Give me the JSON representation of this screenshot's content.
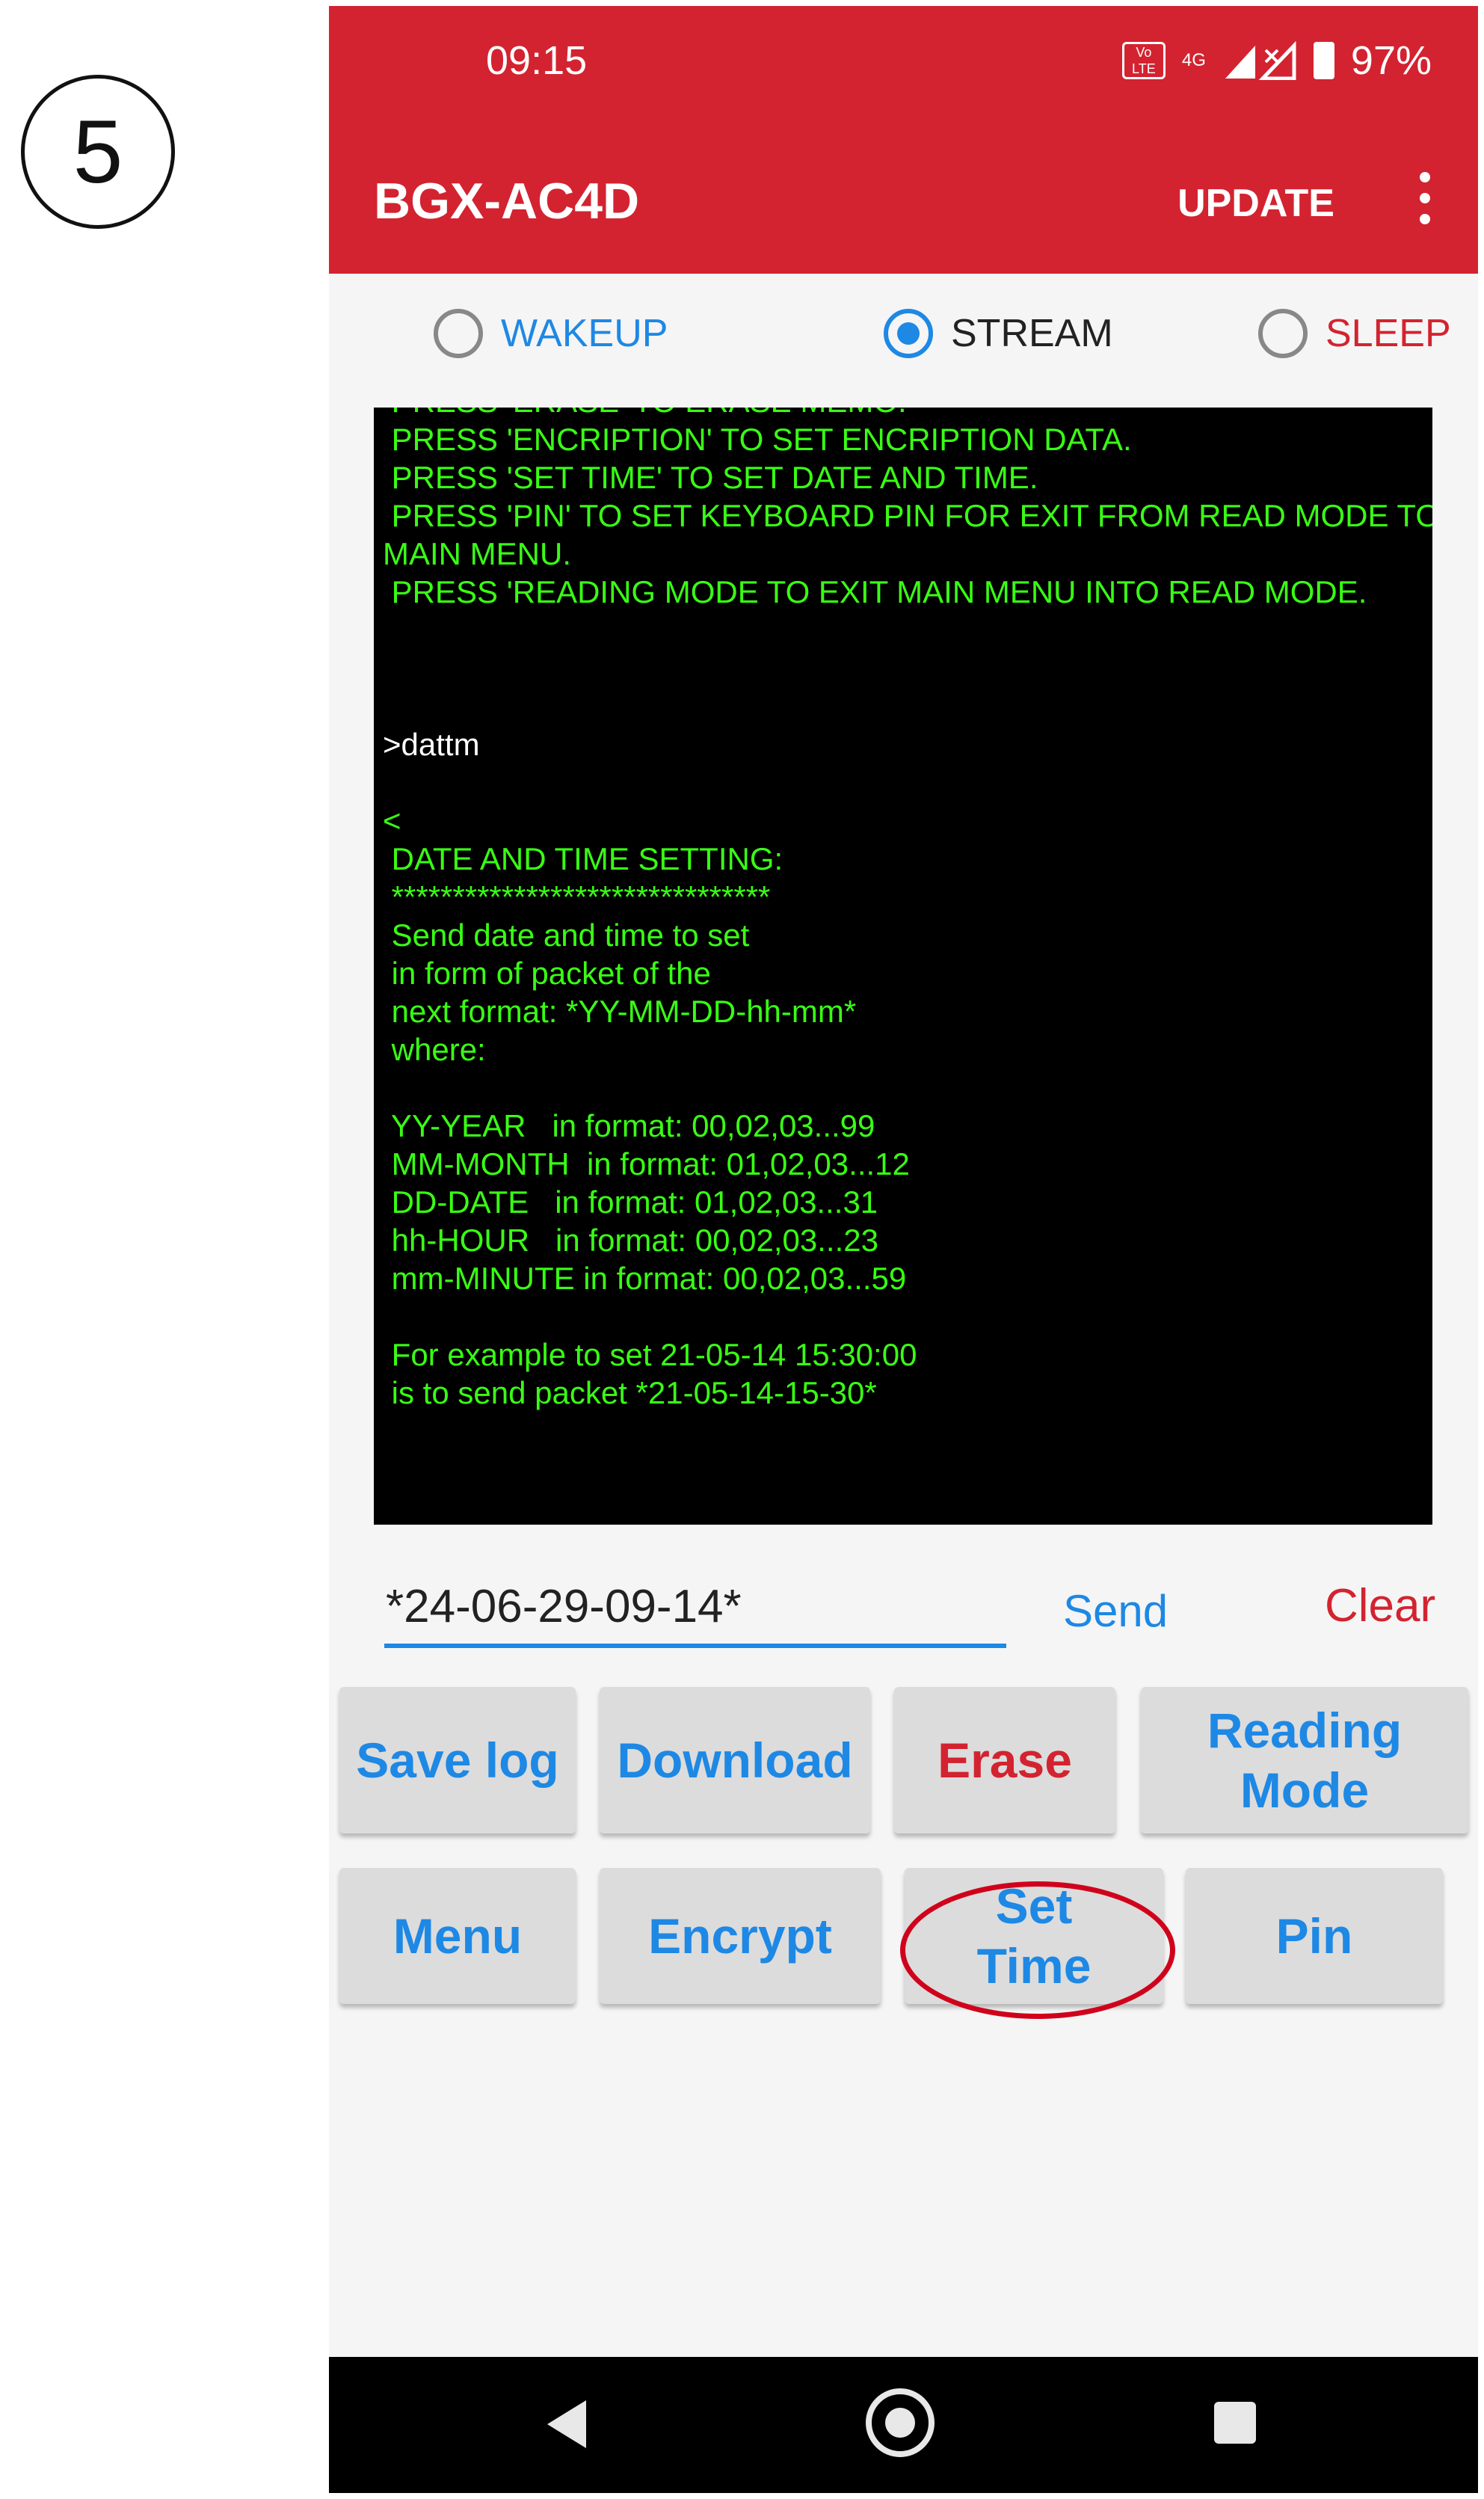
{
  "annotation": {
    "step_number": "5"
  },
  "status_bar": {
    "time": "09:15",
    "volte": "VoLTE",
    "network": "4G",
    "battery": "97%"
  },
  "app_bar": {
    "title": "BGX-AC4D",
    "update_label": "UPDATE"
  },
  "modes": [
    {
      "label": "WAKEUP",
      "selected": false,
      "color": "#1e88e5"
    },
    {
      "label": "STREAM",
      "selected": true,
      "color": "#222222"
    },
    {
      "label": "SLEEP",
      "selected": false,
      "color": "#d32330"
    }
  ],
  "terminal": {
    "lines": [
      " PRESS 'ERASE' TO ERASE MEMO.",
      " PRESS 'ENCRIPTION' TO SET ENCRIPTION DATA.",
      " PRESS 'SET TIME' TO SET DATE AND TIME.",
      " PRESS 'PIN' TO SET KEYBOARD PIN FOR EXIT FROM READ MODE TO",
      "MAIN MENU.",
      " PRESS 'READING MODE TO EXIT MAIN MENU INTO READ MODE.",
      "",
      "",
      "",
      ">dattm",
      "",
      "<",
      " DATE AND TIME SETTING:",
      " *******************************",
      " Send date and time to set",
      " in form of packet of the",
      " next format: *YY-MM-DD-hh-mm*",
      " where:",
      "",
      " YY-YEAR   in format: 00,02,03...99",
      " MM-MONTH  in format: 01,02,03...12",
      " DD-DATE   in format: 01,02,03...31",
      " hh-HOUR   in format: 00,02,03...23",
      " mm-MINUTE in format: 00,02,03...59",
      "",
      " For example to set 21-05-14 15:30:00",
      " is to send packet *21-05-14-15-30*"
    ],
    "text_color": "#39ff14",
    "command_color": "#ffffff"
  },
  "command": {
    "value": "*24-06-29-09-14*",
    "send_label": "Send",
    "clear_label": "Clear"
  },
  "buttons_row1": {
    "save_log": "Save log",
    "download": "Download",
    "erase": "Erase",
    "reading_line1": "Reading",
    "reading_line2": "Mode"
  },
  "buttons_row2": {
    "menu": "Menu",
    "encrypt": "Encrypt",
    "set_line1": "Set",
    "set_line2": "Time",
    "pin": "Pin"
  },
  "colors": {
    "brand_red": "#d32330",
    "accent_blue": "#1e88e5",
    "highlight_ring": "#d0021b"
  },
  "icons": {
    "nav_back": "back-triangle-icon",
    "nav_home": "home-circle-icon",
    "nav_recent": "recents-square-icon",
    "overflow": "more-vertical-icon"
  }
}
